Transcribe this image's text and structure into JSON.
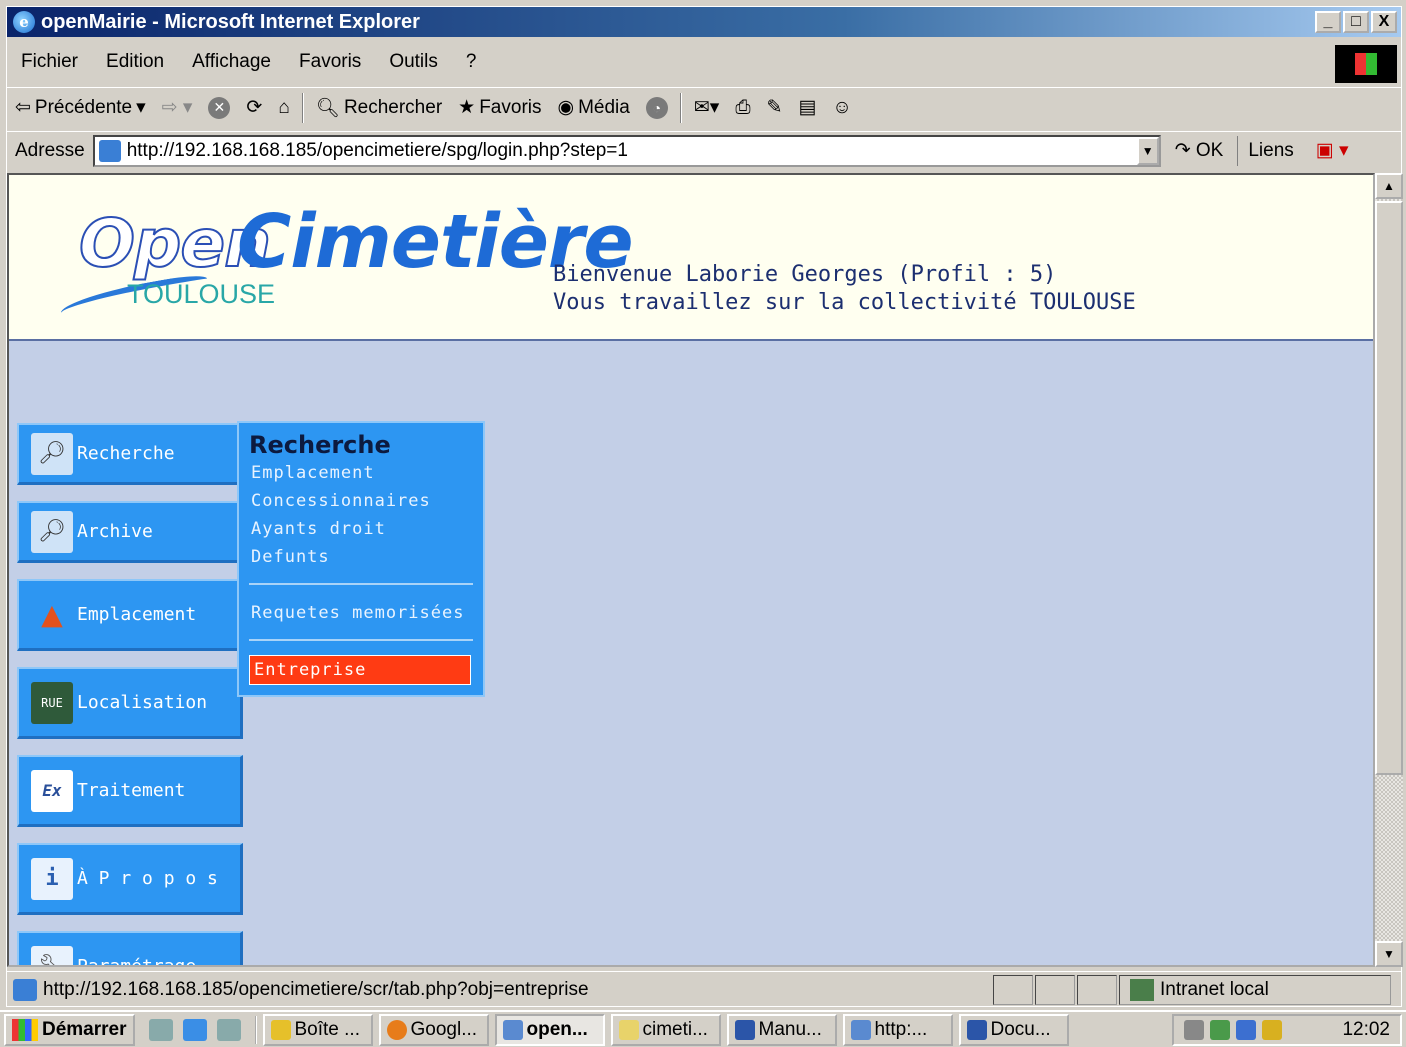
{
  "window": {
    "title": "openMairie - Microsoft Internet Explorer",
    "controls": [
      "_",
      "□",
      "X"
    ]
  },
  "menu": [
    "Fichier",
    "Edition",
    "Affichage",
    "Favoris",
    "Outils",
    "?"
  ],
  "toolbar": {
    "back": "Précédente",
    "search": "Rechercher",
    "favorites": "Favoris",
    "media": "Média"
  },
  "address": {
    "label": "Adresse",
    "url": "http://192.168.168.185/opencimetiere/spg/login.php?step=1",
    "go": "OK",
    "links": "Liens"
  },
  "page": {
    "logo_open": "Open",
    "logo_cimetiere": "Cimetière",
    "logo_city": "TOULOUSE",
    "welcome_line1": "Bienvenue Laborie Georges (Profil : 5)",
    "welcome_line2": "Vous travaillez sur la collectivité TOULOUSE",
    "nav": [
      {
        "label": "Recherche",
        "icon": "search-icon"
      },
      {
        "label": "Archive",
        "icon": "archive-search-icon"
      },
      {
        "label": "Emplacement",
        "icon": "pyramid-icon"
      },
      {
        "label": "Localisation",
        "icon": "street-sign-icon"
      },
      {
        "label": "Traitement",
        "icon": "ex-icon"
      },
      {
        "label": "À P r o p o s",
        "icon": "info-icon"
      },
      {
        "label": "Paramétrage",
        "icon": "wrench-icon"
      }
    ],
    "submenu": {
      "title": "Recherche",
      "links": [
        "Emplacement",
        "Concessionnaires",
        "Ayants droit",
        "Defunts"
      ],
      "saved": "Requetes memorisées",
      "active": "Entreprise"
    }
  },
  "status": {
    "url": "http://192.168.168.185/opencimetiere/scr/tab.php?obj=entreprise",
    "zone": "Intranet local"
  },
  "taskbar": {
    "start": "Démarrer",
    "tasks": [
      "Boîte ...",
      "Googl...",
      "open...",
      "cimeti...",
      "Manu...",
      "http:...",
      "Docu..."
    ],
    "clock": "12:02"
  },
  "colors": {
    "page_background": "#c3cfe7",
    "nav_blue": "#2d96f2",
    "active_item": "#ff3b13",
    "header_background": "#fffff0"
  }
}
